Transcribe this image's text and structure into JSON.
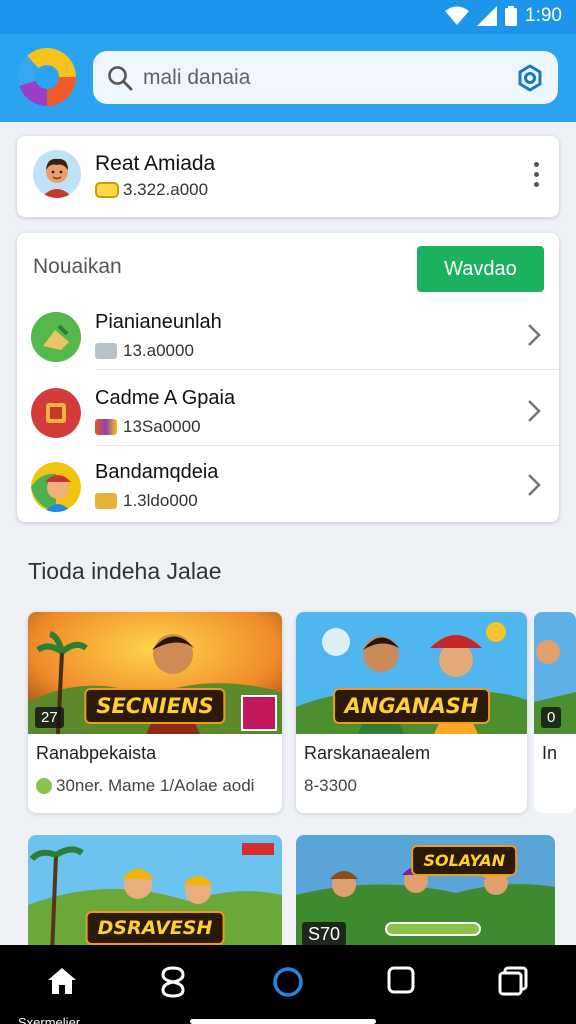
{
  "status_bar": {
    "time": "1:90"
  },
  "header": {
    "search": {
      "value": "mali danaia"
    }
  },
  "profile": {
    "name": "Reat Amiada",
    "balance": "3.322.a000"
  },
  "list_section": {
    "title": "Nouaikan",
    "button_label": "Wavdao",
    "items": [
      {
        "title": "Pianianeunlah",
        "sub": "13.a0000"
      },
      {
        "title": "Cadme A Gpaia",
        "sub": "13Sa0000"
      },
      {
        "title": "Bandamqdeia",
        "sub": "1.3ldo000"
      }
    ]
  },
  "recommended": {
    "title": "Tioda indeha Jalae",
    "games": [
      {
        "image_title": "SECNIENS",
        "image_badge": "27",
        "name": "Ranabpekaista",
        "sub": "30ner. Mame  1/Aolae aodi"
      },
      {
        "image_title": "ANGANASH",
        "image_badge": "",
        "name": "Rarskanaealem",
        "sub": "8-3300"
      },
      {
        "image_title": "",
        "image_badge": "0",
        "name": "In",
        "sub": ""
      }
    ],
    "games_row2": [
      {
        "image_title": "DSRAVESH",
        "image_badge": ""
      },
      {
        "image_title": "SOLAYAN",
        "image_badge": "S70"
      }
    ]
  },
  "bottom_nav": {
    "home_label": "Sxermelier"
  },
  "colors": {
    "app_bar": "#2aa3f0",
    "status_bar": "#1c95ea",
    "primary_button": "#1bb25f"
  }
}
